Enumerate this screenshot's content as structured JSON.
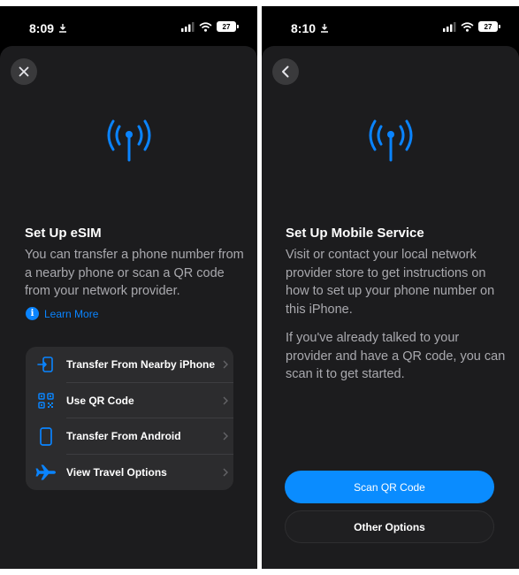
{
  "left_screen": {
    "status": {
      "time": "8:09",
      "battery": "27"
    },
    "title": "Set Up eSIM",
    "body": "You can transfer a phone number from a nearby phone or scan a QR code from your network provider.",
    "learn_more": "Learn More",
    "options": [
      {
        "label": "Transfer From Nearby iPhone",
        "icon": "transfer-phone-icon"
      },
      {
        "label": "Use QR Code",
        "icon": "qr-code-icon"
      },
      {
        "label": "Transfer From Android",
        "icon": "phone-outline-icon"
      },
      {
        "label": "View Travel Options",
        "icon": "airplane-icon"
      }
    ]
  },
  "right_screen": {
    "status": {
      "time": "8:10",
      "battery": "27"
    },
    "title": "Set Up Mobile Service",
    "body_1": "Visit or contact your local network provider store to get instructions on how to set up your phone number on this iPhone.",
    "body_2": "If you've already talked to your provider and have a QR code, you can scan it to get started.",
    "primary_button": "Scan QR Code",
    "secondary_button": "Other Options"
  },
  "colors": {
    "accent": "#0a84ff",
    "sheet_background": "#1c1c1e",
    "list_background": "#2c2c2e",
    "secondary_text": "#a9a9ae"
  }
}
